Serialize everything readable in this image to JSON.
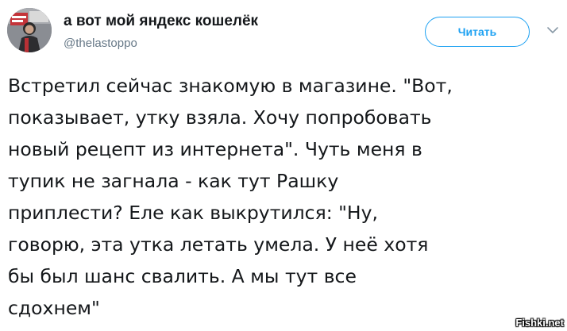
{
  "author": {
    "display_name": "а вот мой яндекс кошелёк",
    "handle": "@thelastoppo",
    "avatar_icon": "profile-photo"
  },
  "actions": {
    "follow_label": "Читать",
    "more_icon": "chevron-down-icon",
    "accent_color": "#1da1f2"
  },
  "tweet": {
    "lines": [
      "Встретил сейчас знакомую в магазине. \"Вот,",
      "показывает, утку взяла. Хочу попробовать",
      "новый рецепт из интернета\". Чуть меня в",
      "тупик не загнала - как тут Рашку",
      "приплести? Еле как выкрутился: \"Ну,",
      "говорю, эта утка летать умела. У неё хотя",
      "бы был шанс свалить. А мы тут все",
      "сдохнем\""
    ]
  },
  "watermark": {
    "text": "Fishki.net"
  }
}
